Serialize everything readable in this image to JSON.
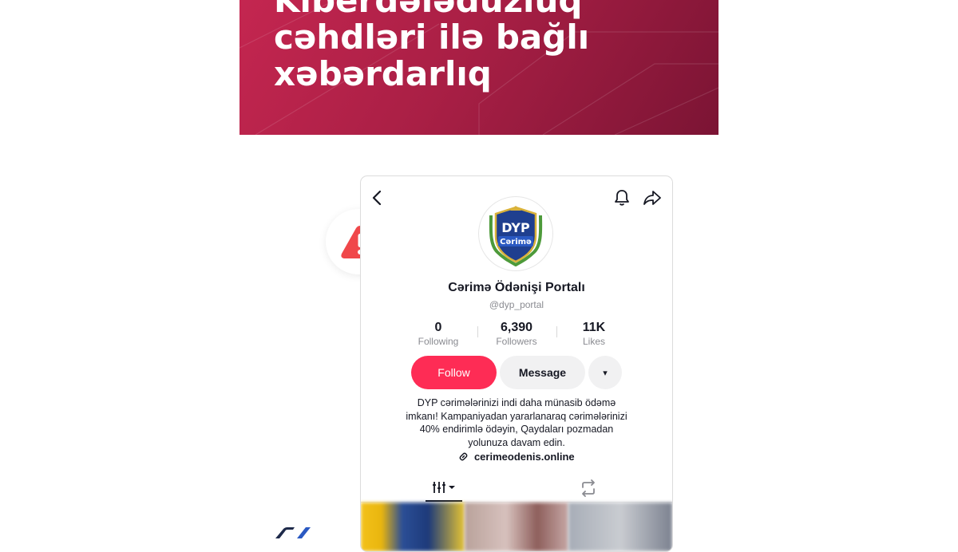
{
  "banner": {
    "title_line1": "Kiberdələduzluq",
    "title_line2": "cəhdləri ilə bağlı",
    "title_line3": "xəbərdarlıq"
  },
  "alert": {
    "icon": "warning-triangle-icon",
    "color": "#f0474a"
  },
  "profile": {
    "avatar_text": "DYP",
    "avatar_subtext": "Cərimə",
    "name": "Cərimə Ödənişi Portalı",
    "handle": "@dyp_portal",
    "stats": [
      {
        "value": "0",
        "label": "Following"
      },
      {
        "value": "6,390",
        "label": "Followers"
      },
      {
        "value": "11K",
        "label": "Likes"
      }
    ],
    "follow_label": "Follow",
    "message_label": "Message",
    "more_label": "▾",
    "bio_line1": "DYP cərimələrinizi indi daha münasib ödəmə",
    "bio_line2": "imkanı!  Kampaniyadan yararlanaraq cərimələrinizi",
    "bio_line3": "40% endirimlə ödəyin, Qaydaları pozmadan",
    "bio_line4": "yolunuza davam edin.",
    "link": "cerimeodenis.online"
  },
  "colors": {
    "accent": "#fe2c55",
    "banner": "#b32048",
    "text": "#161823",
    "muted": "#8a8b91"
  }
}
